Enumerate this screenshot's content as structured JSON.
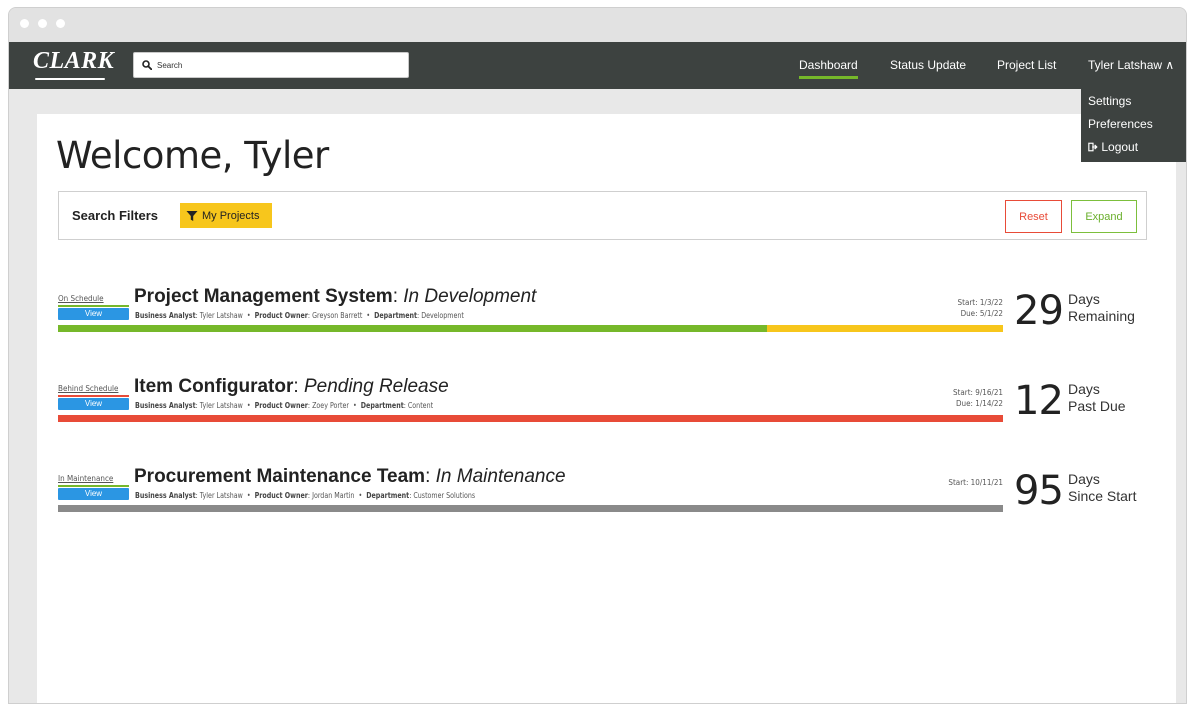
{
  "window": {
    "controls": [
      "close",
      "minimize",
      "maximize"
    ]
  },
  "navbar": {
    "logo": "CLARK",
    "search": {
      "placeholder": "Search",
      "value": ""
    },
    "links": [
      {
        "label": "Dashboard",
        "active": true
      },
      {
        "label": "Status Update",
        "active": false
      },
      {
        "label": "Project List",
        "active": false
      }
    ],
    "user_menu": {
      "label": "Tyler Latshaw ∧"
    }
  },
  "dropdown": {
    "items": [
      {
        "label": "Settings"
      },
      {
        "label": "Preferences"
      },
      {
        "label": "Logout",
        "icon": "logout-icon"
      }
    ]
  },
  "page": {
    "title": "Welcome, Tyler"
  },
  "filters": {
    "label": "Search Filters",
    "chip": {
      "label": "My Projects",
      "icon": "filter-icon",
      "color": "#f7c61c"
    },
    "reset_label": "Reset",
    "expand_label": "Expand"
  },
  "projects": [
    {
      "status": "On Schedule",
      "status_color": "#76b82a",
      "view_label": "View",
      "name": "Project Management System",
      "sep": ": ",
      "phase": "In Development",
      "ba_label": "Business Analyst",
      "ba": "Tyler Latshaw",
      "po_label": "Product Owner",
      "po": "Greyson Barrett",
      "dept_label": "Department",
      "dept": "Development",
      "start": "Start: 1/3/22",
      "due": "Due: 5/1/22",
      "progress_fraction": 0.75,
      "progress_colors": [
        "#76b82a",
        "#f7c61c"
      ],
      "count": "29",
      "count_line1": "Days",
      "count_line2": "Remaining"
    },
    {
      "status": "Behind Schedule",
      "status_color": "#e84b38",
      "view_label": "View",
      "name": "Item Configurator",
      "sep": ": ",
      "phase": "Pending Release",
      "ba_label": "Business Analyst",
      "ba": "Tyler Latshaw",
      "po_label": "Product Owner",
      "po": "Zoey Porter",
      "dept_label": "Department",
      "dept": "Content",
      "start": "Start: 9/16/21",
      "due": "Due: 1/14/22",
      "progress_fraction": 1.0,
      "progress_colors": [
        "#e84b38",
        "#e84b38"
      ],
      "count": "12",
      "count_line1": "Days",
      "count_line2": "Past Due"
    },
    {
      "status": "In Maintenance",
      "status_color": "#76b82a",
      "view_label": "View",
      "name": "Procurement Maintenance Team",
      "sep": ": ",
      "phase": "In Maintenance",
      "ba_label": "Business Analyst",
      "ba": "Tyler Latshaw",
      "po_label": "Product Owner",
      "po": "Jordan Martin",
      "dept_label": "Department",
      "dept": "Customer Solutions",
      "start": "Start: 10/11/21",
      "due": "",
      "progress_fraction": 1.0,
      "progress_colors": [
        "#8a8a8a",
        "#8a8a8a"
      ],
      "count": "95",
      "count_line1": "Days",
      "count_line2": "Since Start"
    }
  ]
}
